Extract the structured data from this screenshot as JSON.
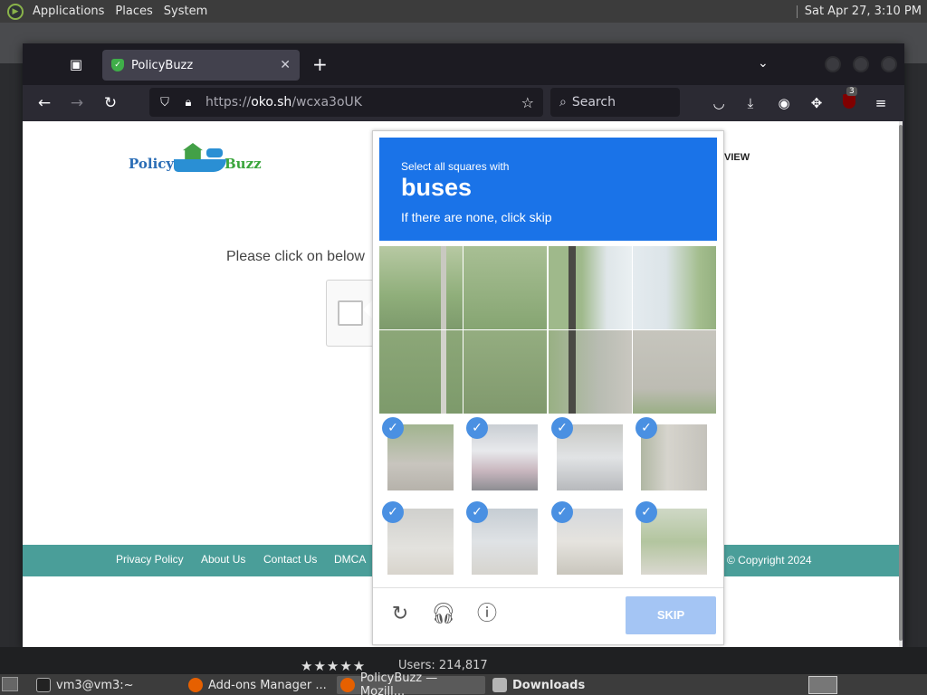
{
  "top_panel": {
    "menus": [
      "Applications",
      "Places",
      "System"
    ],
    "clock": "Sat Apr 27,  3:10 PM"
  },
  "browser": {
    "tab_title": "PolicyBuzz",
    "url_host": "oko.sh",
    "url_path": "/wcxa3oUK",
    "url_scheme": "https://",
    "search_placeholder": "Search",
    "extension_badge": "3"
  },
  "page": {
    "logo_word1": "Policy",
    "logo_word2": "Buzz",
    "nav_partial": "VIEW",
    "prompt": "Please click on below",
    "footer_links": [
      "Privacy Policy",
      "About Us",
      "Contact Us",
      "DMCA"
    ],
    "copyright": "© Copyright 2024"
  },
  "captcha": {
    "instruction_small": "Select all squares with",
    "target": "buses",
    "instruction_hint": "If there are none, click skip",
    "skip_label": "SKIP",
    "selected_count": 8,
    "colors": {
      "header": "#1a73e8",
      "check": "#4a90e2",
      "skip": "#a4c5f4"
    }
  },
  "below_page": {
    "stars": "★★★★★",
    "users": "Users: 214,817"
  },
  "taskbar": {
    "items": [
      "vm3@vm3:~",
      "Add-ons Manager ...",
      "PolicyBuzz — Mozill...",
      "Downloads"
    ]
  }
}
